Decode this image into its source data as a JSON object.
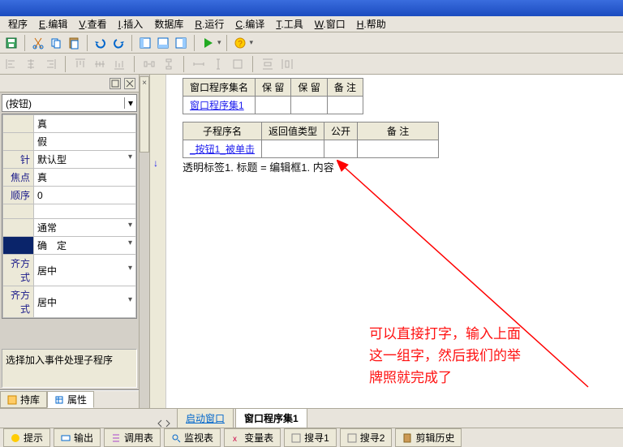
{
  "title": "",
  "menu": {
    "items": [
      {
        "u": "",
        "label": "程序"
      },
      {
        "u": "E",
        "label": ".编辑"
      },
      {
        "u": "V",
        "label": ".查看"
      },
      {
        "u": "I",
        "label": ".插入"
      },
      {
        "u": "",
        "label": "数据库"
      },
      {
        "u": "R",
        "label": ".运行"
      },
      {
        "u": "C",
        "label": ".编译"
      },
      {
        "u": "T",
        "label": ".工具"
      },
      {
        "u": "W",
        "label": ".窗口"
      },
      {
        "u": "H",
        "label": ".帮助"
      }
    ]
  },
  "prop": {
    "selected": "(按钮)",
    "rows": [
      {
        "k": "",
        "v": "真"
      },
      {
        "k": "",
        "v": "假"
      },
      {
        "k": "针",
        "v": "默认型",
        "combo": true
      },
      {
        "k": "焦点",
        "v": "真"
      },
      {
        "k": "顺序",
        "v": "0"
      },
      {
        "k": "",
        "v": ""
      },
      {
        "k": "",
        "v": "通常",
        "combo": true
      },
      {
        "k": "",
        "v": "确　定",
        "combo": true,
        "sel": true
      },
      {
        "k": "齐方式",
        "v": "居中",
        "combo": true
      },
      {
        "k": "齐方式",
        "v": "居中",
        "combo": true
      }
    ]
  },
  "left_hint": "选择加入事件处理子程序",
  "left_tabs": {
    "a": "持库",
    "b": "属性"
  },
  "tables": {
    "t1": {
      "headers": [
        "窗口程序集名",
        "保  留",
        "保  留",
        "备  注"
      ],
      "rows": [
        [
          "窗口程序集1",
          "",
          "",
          ""
        ]
      ]
    },
    "t2": {
      "headers": [
        "子程序名",
        "返回值类型",
        "公开",
        "备  注"
      ],
      "rows": [
        [
          "_按钮1_被单击",
          "",
          "",
          ""
        ]
      ]
    }
  },
  "code": "透明标签1. 标题  =  编辑框1. 内容",
  "editor_tabs": {
    "a": "启动窗口",
    "b": "窗口程序集1"
  },
  "status": {
    "tips": "提示",
    "out": "输出",
    "calls": "调用表",
    "watch": "监视表",
    "vars": "变量表",
    "find1": "搜寻1",
    "find2": "搜寻2",
    "clip": "剪辑历史"
  },
  "annotation": "可以直接打字，输入上面\n这一组字，然后我们的举\n牌照就完成了"
}
